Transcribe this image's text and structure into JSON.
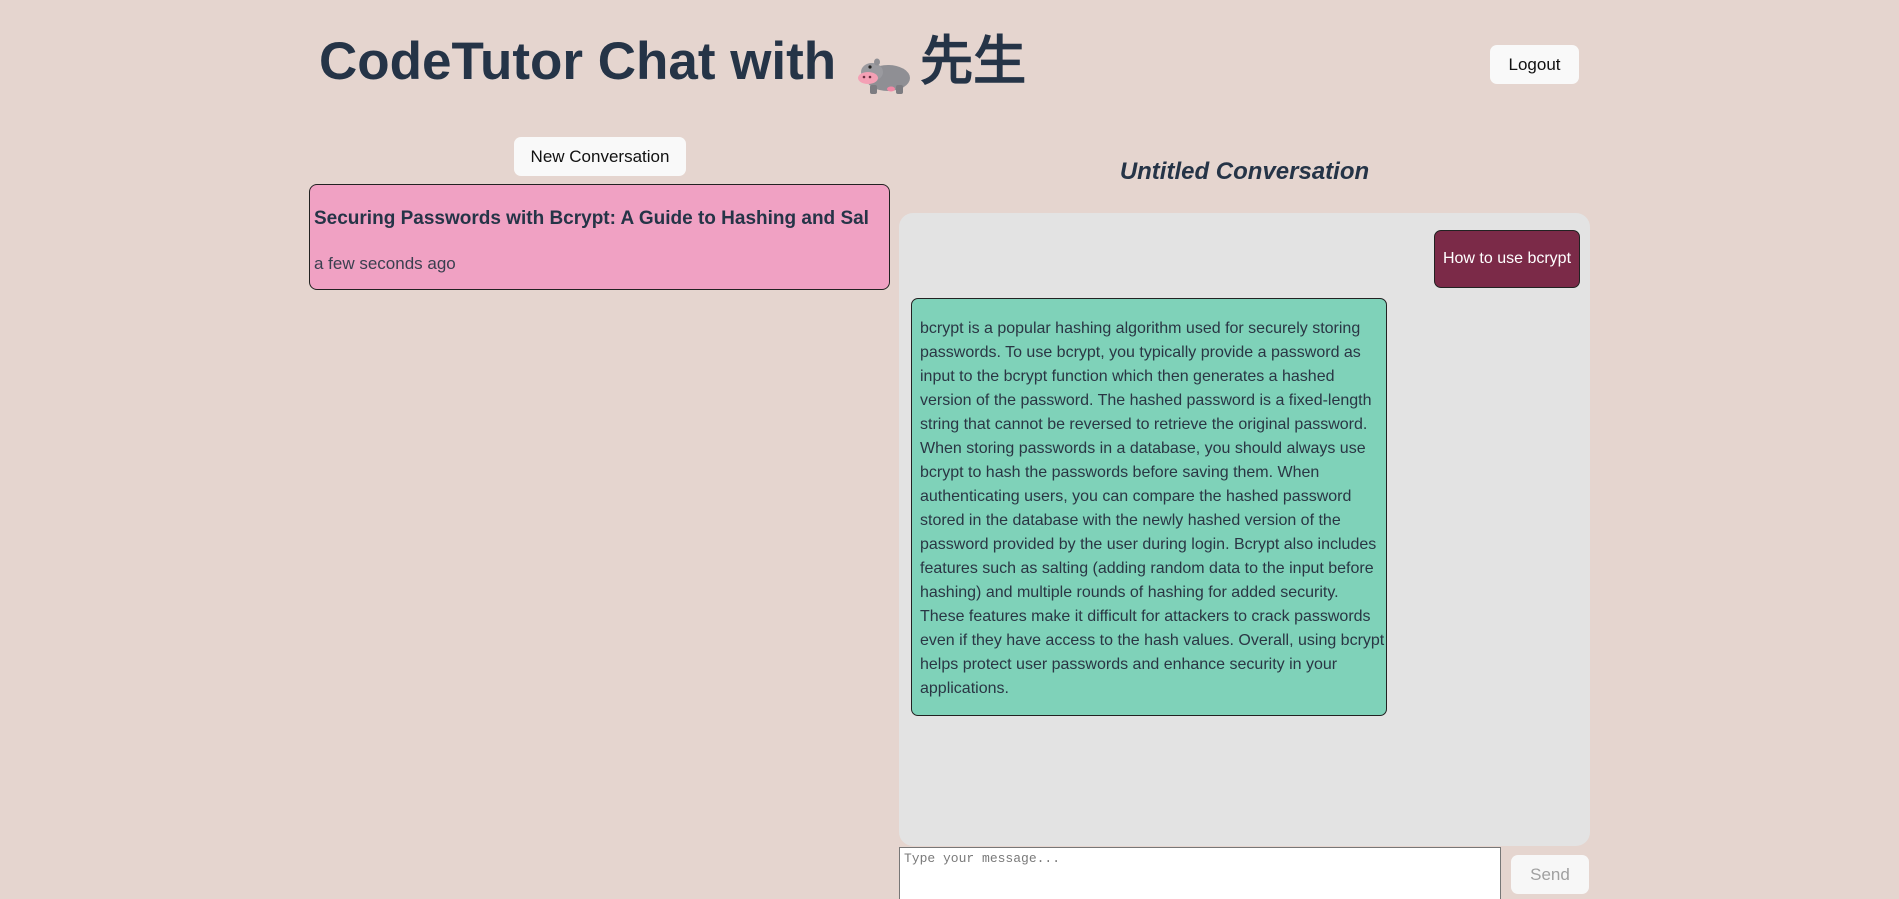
{
  "header": {
    "title_prefix": "CodeTutor Chat with",
    "title_suffix": "先生",
    "mascot_icon": "hippo-icon",
    "logout_label": "Logout"
  },
  "sidebar": {
    "new_conversation_label": "New Conversation",
    "conversations": [
      {
        "title": "Securing Passwords with Bcrypt: A Guide to Hashing and Sal",
        "time": "a few seconds ago",
        "color": "#f0a1c3"
      }
    ]
  },
  "chat": {
    "conversation_title": "Untitled Conversation",
    "messages": [
      {
        "role": "user",
        "text": "How to use bcrypt",
        "color": "#7b2a48"
      },
      {
        "role": "assistant",
        "text": "bcrypt is a popular hashing algorithm used for securely storing passwords. To use bcrypt, you typically provide a password as input to the bcrypt function which then generates a hashed version of the password. The hashed password is a fixed-length string that cannot be reversed to retrieve the original password. When storing passwords in a database, you should always use bcrypt to hash the passwords before saving them. When authenticating users, you can compare the hashed password stored in the database with the newly hashed version of the password provided by the user during login. Bcrypt also includes features such as salting (adding random data to the input before hashing) and multiple rounds of hashing for added security. These features make it difficult for attackers to crack passwords even if they have access to the hash values. Overall, using bcrypt helps protect user passwords and enhance security in your applications.",
        "color": "#7fd2b9"
      }
    ],
    "input": {
      "value": "",
      "placeholder": "Type your message..."
    },
    "send_label": "Send"
  },
  "colors": {
    "background": "#e5d5cf",
    "title_text": "#253447",
    "chat_panel": "#e3e3e3"
  }
}
